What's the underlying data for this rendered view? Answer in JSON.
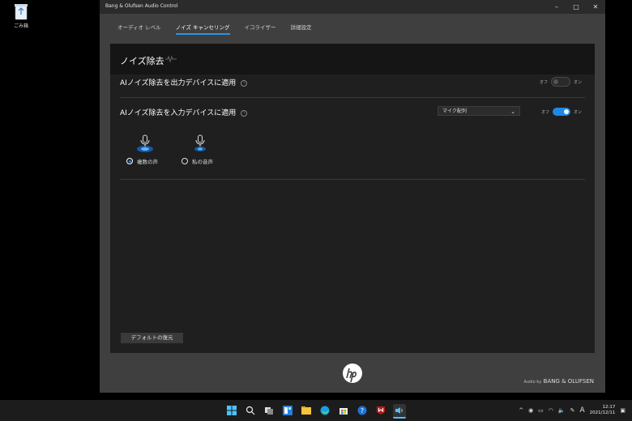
{
  "desktop": {
    "recycle_bin_label": "ごみ箱"
  },
  "window": {
    "title": "Bang & Olufsen Audio Control",
    "controls": {
      "minimize": "–",
      "maximize": "□",
      "close": "✕"
    },
    "tabs": [
      {
        "label": "オーディオ レベル",
        "active": false
      },
      {
        "label": "ノイズ キャンセリング",
        "active": true
      },
      {
        "label": "イコライザー",
        "active": false
      },
      {
        "label": "詳細設定",
        "active": false
      }
    ],
    "panel_title": "ノイズ除去",
    "info_glyph": "i",
    "output_row": {
      "label": "AIノイズ除去を出力デバイスに適用",
      "off_label": "オフ",
      "on_label": "オン",
      "enabled": false
    },
    "input_row": {
      "label": "AIノイズ除去を入力デバイスに適用",
      "select_value": "マイク配列",
      "off_label": "オフ",
      "on_label": "オン",
      "enabled": true,
      "options": [
        {
          "label": "複数の声",
          "selected": true
        },
        {
          "label": "私の音声",
          "selected": false
        }
      ]
    },
    "reset_button": "デフォルトの復元",
    "brand": {
      "prefix": "Audio by",
      "name": "BANG & OLUFSEN"
    }
  },
  "taskbar": {
    "icons": [
      "windows-start-icon",
      "search-icon",
      "task-view-icon",
      "widgets-icon",
      "file-explorer-icon",
      "edge-icon",
      "store-icon",
      "help-icon",
      "mcafee-icon",
      "audio-control-icon"
    ],
    "tray": {
      "ime": "A",
      "time": "12:17",
      "date": "2021/12/11",
      "chevron": "^"
    }
  },
  "colors": {
    "accent": "#1e88e5",
    "window_bg": "#3f3f3f",
    "panel_bg": "#1f1f1f"
  }
}
